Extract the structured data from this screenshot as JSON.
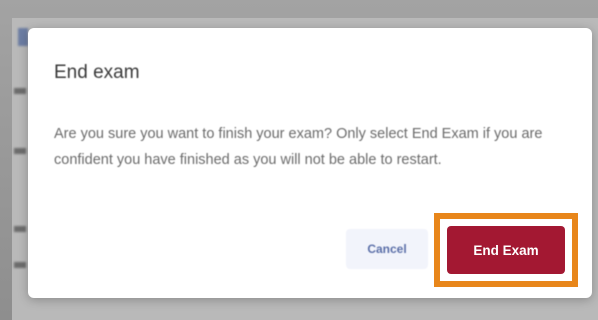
{
  "dialog": {
    "title": "End exam",
    "message": "Are you sure you want to finish your exam? Only select End Exam if you are confident you have finished as you will not be able to restart.",
    "cancel_label": "Cancel",
    "confirm_label": "End Exam"
  },
  "colors": {
    "confirm_button": "#a31832",
    "highlight_outline": "#e8861a",
    "cancel_text": "#5b6fa8",
    "cancel_background": "#f2f4fb"
  }
}
